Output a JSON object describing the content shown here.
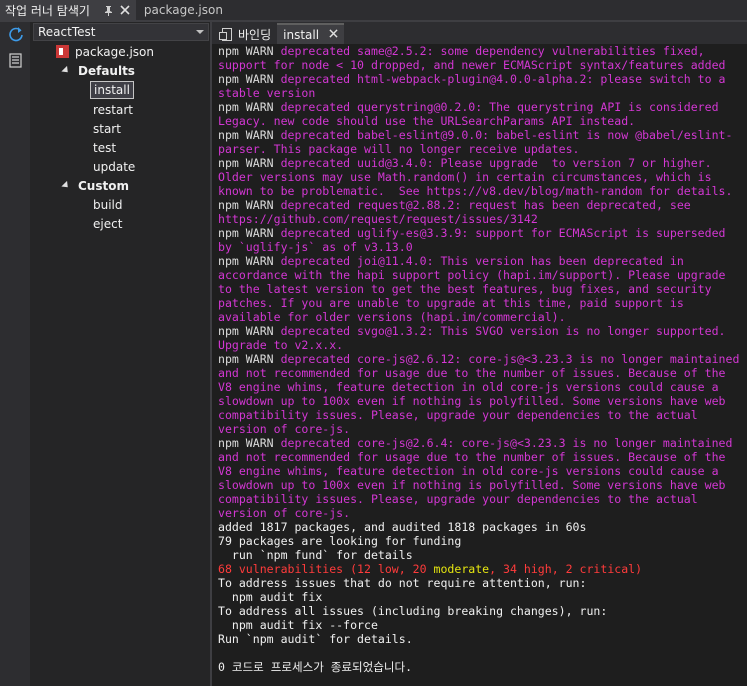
{
  "titlebar": {
    "tool_window_title": "작업 러너 탐색기",
    "pin_icon": "pin-icon",
    "close_icon": "close-icon",
    "file_tab": "package.json"
  },
  "explorer": {
    "project": "ReactTest",
    "file": "package.json",
    "groups": [
      {
        "label": "Defaults",
        "items": [
          "install",
          "restart",
          "start",
          "test",
          "update"
        ]
      },
      {
        "label": "Custom",
        "items": [
          "build",
          "eject"
        ]
      }
    ],
    "selected_item": "install"
  },
  "output": {
    "tabs": [
      {
        "label": "바인딩",
        "icon": "binding-icon"
      },
      {
        "label": "install",
        "active": true
      }
    ],
    "lines": [
      [
        [
          "c-gray",
          "npm WARN "
        ],
        [
          "c-mag",
          "deprecated same@2.5.2: some dependency vulnerabilities fixed,"
        ]
      ],
      [
        [
          "c-mag",
          "support for node < 10 dropped, and newer ECMAScript syntax/features added"
        ]
      ],
      [
        [
          "c-gray",
          "npm WARN "
        ],
        [
          "c-mag",
          "deprecated html-webpack-plugin@4.0.0-alpha.2: please switch to a"
        ]
      ],
      [
        [
          "c-mag",
          "stable version"
        ]
      ],
      [
        [
          "c-gray",
          "npm WARN "
        ],
        [
          "c-mag",
          "deprecated querystring@0.2.0: The querystring API is considered"
        ]
      ],
      [
        [
          "c-mag",
          "Legacy. new code should use the URLSearchParams API instead."
        ]
      ],
      [
        [
          "c-gray",
          "npm WARN "
        ],
        [
          "c-mag",
          "deprecated babel-eslint@9.0.0: babel-eslint is now @babel/eslint-"
        ]
      ],
      [
        [
          "c-mag",
          "parser. This package will no longer receive updates."
        ]
      ],
      [
        [
          "c-gray",
          "npm WARN "
        ],
        [
          "c-mag",
          "deprecated uuid@3.4.0: Please upgrade  to version 7 or higher."
        ]
      ],
      [
        [
          "c-mag",
          "Older versions may use Math.random() in certain circumstances, which is"
        ]
      ],
      [
        [
          "c-mag",
          "known to be problematic.  See https://v8.dev/blog/math-random for details."
        ]
      ],
      [
        [
          "c-gray",
          "npm WARN "
        ],
        [
          "c-mag",
          "deprecated request@2.88.2: request has been deprecated, see"
        ]
      ],
      [
        [
          "c-mag",
          "https://github.com/request/request/issues/3142"
        ]
      ],
      [
        [
          "c-gray",
          "npm WARN "
        ],
        [
          "c-mag",
          "deprecated uglify-es@3.3.9: support for ECMAScript is superseded"
        ]
      ],
      [
        [
          "c-mag",
          "by `uglify-js` as of v3.13.0"
        ]
      ],
      [
        [
          "c-gray",
          "npm WARN "
        ],
        [
          "c-mag",
          "deprecated joi@11.4.0: This version has been deprecated in"
        ]
      ],
      [
        [
          "c-mag",
          "accordance with the hapi support policy (hapi.im/support). Please upgrade"
        ]
      ],
      [
        [
          "c-mag",
          "to the latest version to get the best features, bug fixes, and security"
        ]
      ],
      [
        [
          "c-mag",
          "patches. If you are unable to upgrade at this time, paid support is"
        ]
      ],
      [
        [
          "c-mag",
          "available for older versions (hapi.im/commercial)."
        ]
      ],
      [
        [
          "c-gray",
          "npm WARN "
        ],
        [
          "c-mag",
          "deprecated svgo@1.3.2: This SVGO version is no longer supported."
        ]
      ],
      [
        [
          "c-mag",
          "Upgrade to v2.x.x."
        ]
      ],
      [
        [
          "c-gray",
          "npm WARN "
        ],
        [
          "c-mag",
          "deprecated core-js@2.6.12: core-js@<3.23.3 is no longer maintained"
        ]
      ],
      [
        [
          "c-mag",
          "and not recommended for usage due to the number of issues. Because of the"
        ]
      ],
      [
        [
          "c-mag",
          "V8 engine whims, feature detection in old core-js versions could cause a"
        ]
      ],
      [
        [
          "c-mag",
          "slowdown up to 100x even if nothing is polyfilled. Some versions have web"
        ]
      ],
      [
        [
          "c-mag",
          "compatibility issues. Please, upgrade your dependencies to the actual"
        ]
      ],
      [
        [
          "c-mag",
          "version of core-js."
        ]
      ],
      [
        [
          "c-gray",
          "npm WARN "
        ],
        [
          "c-mag",
          "deprecated core-js@2.6.4: core-js@<3.23.3 is no longer maintained"
        ]
      ],
      [
        [
          "c-mag",
          "and not recommended for usage due to the number of issues. Because of the"
        ]
      ],
      [
        [
          "c-mag",
          "V8 engine whims, feature detection in old core-js versions could cause a"
        ]
      ],
      [
        [
          "c-mag",
          "slowdown up to 100x even if nothing is polyfilled. Some versions have web"
        ]
      ],
      [
        [
          "c-mag",
          "compatibility issues. Please, upgrade your dependencies to the actual"
        ]
      ],
      [
        [
          "c-mag",
          "version of core-js."
        ]
      ],
      [
        [
          "c-wht",
          "added 1817 packages, and audited 1818 packages in 60s"
        ]
      ],
      [
        [
          "c-wht",
          "79 packages are looking for funding"
        ]
      ],
      [
        [
          "c-wht",
          "  run `npm fund` for details"
        ]
      ],
      [
        [
          "c-red",
          "68 vulnerabilities (12 low, 20 "
        ],
        [
          "c-yel",
          "moderate"
        ],
        [
          "c-red",
          ", 34 high, 2 critical)"
        ]
      ],
      [
        [
          "c-wht",
          "To address issues that do not require attention, run:"
        ]
      ],
      [
        [
          "c-wht",
          "  npm audit fix"
        ]
      ],
      [
        [
          "c-wht",
          "To address all issues (including breaking changes), run:"
        ]
      ],
      [
        [
          "c-wht",
          "  npm audit fix --force"
        ]
      ],
      [
        [
          "c-wht",
          "Run `npm audit` for details."
        ]
      ],
      [],
      [
        [
          "c-wht",
          "0 코드로 프로세스가 종료되었습니다."
        ]
      ]
    ]
  },
  "colors": {
    "warn_text": "#dcdcdc",
    "deprecated_text": "#d337d3",
    "vuln_red": "#ff3b3b",
    "moderate_yellow": "#e5e510",
    "npm_brand": "#cb3837"
  }
}
